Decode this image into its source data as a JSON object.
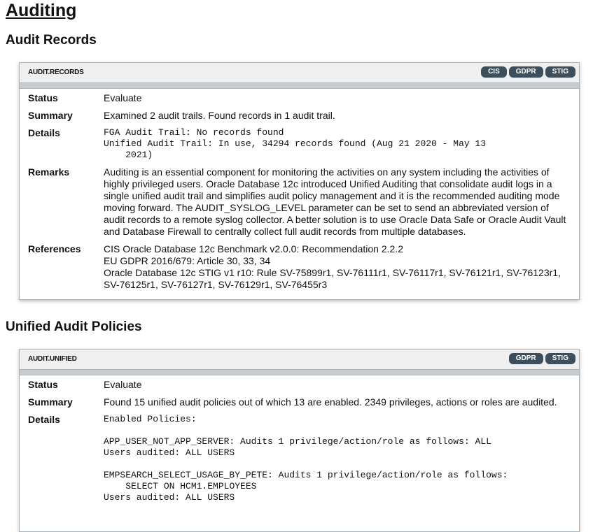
{
  "page_title": "Auditing",
  "sections": [
    {
      "heading": "Audit Records",
      "id": "AUDIT.RECORDS",
      "badges": [
        "CIS",
        "GDPR",
        "STIG"
      ],
      "status_label": "Status",
      "status": "Evaluate",
      "summary_label": "Summary",
      "summary": "Examined 2 audit trails. Found records in 1 audit trail.",
      "details_label": "Details",
      "details": "FGA Audit Trail: No records found\nUnified Audit Trail: In use, 34294 records found (Aug 21 2020 - May 13\n    2021)",
      "remarks_label": "Remarks",
      "remarks": "Auditing is an essential component for monitoring the activities on any system including the activities of highly privileged users. Oracle Database 12c introduced Unified Auditing that consolidate audit logs in a single unified audit trail and simplifies audit policy management and it is the recommended auditing mode moving forward. The AUDIT_SYSLOG_LEVEL parameter can be set to send an abbreviated version of audit records to a remote syslog collector. A better solution is to use Oracle Data Safe or Oracle Audit Vault and Database Firewall to centrally collect full audit records from multiple databases.",
      "references_label": "References",
      "references": [
        "CIS Oracle Database 12c Benchmark v2.0.0: Recommendation 2.2.2",
        "EU GDPR 2016/679: Article 30, 33, 34",
        "Oracle Database 12c STIG v1 r10: Rule SV-75899r1, SV-76111r1, SV-76117r1, SV-76121r1, SV-76123r1, SV-76125r1, SV-76127r1, SV-76129r1, SV-76455r3"
      ]
    },
    {
      "heading": "Unified Audit Policies",
      "id": "AUDIT.UNIFIED",
      "badges": [
        "GDPR",
        "STIG"
      ],
      "status_label": "Status",
      "status": "Evaluate",
      "summary_label": "Summary",
      "summary": "Found 15 unified audit policies out of which 13 are enabled. 2349 privileges, actions or roles are audited.",
      "details_label": "Details",
      "details": "Enabled Policies:\n\nAPP_USER_NOT_APP_SERVER: Audits 1 privilege/action/role as follows: ALL\nUsers audited: ALL USERS\n\nEMPSEARCH_SELECT_USAGE_BY_PETE: Audits 1 privilege/action/role as follows:\n    SELECT ON HCM1.EMPLOYEES\nUsers audited: ALL USERS"
    }
  ]
}
